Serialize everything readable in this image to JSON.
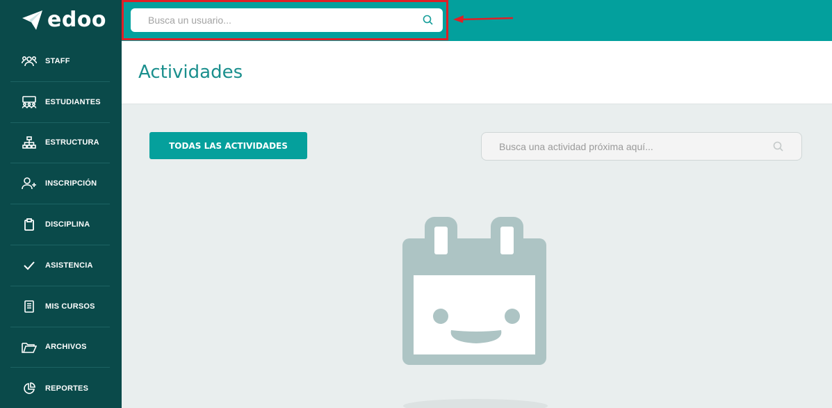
{
  "app": {
    "logo_text": "edoo"
  },
  "sidebar": {
    "items": [
      {
        "label": "STAFF",
        "icon": "staff-icon"
      },
      {
        "label": "ESTUDIANTES",
        "icon": "students-icon"
      },
      {
        "label": "ESTRUCTURA",
        "icon": "structure-icon"
      },
      {
        "label": "INSCRIPCIÓN",
        "icon": "add-user-icon"
      },
      {
        "label": "DISCIPLINA",
        "icon": "clipboard-icon"
      },
      {
        "label": "ASISTENCIA",
        "icon": "checkmark-icon"
      },
      {
        "label": "MIS CURSOS",
        "icon": "book-icon"
      },
      {
        "label": "ARCHIVOS",
        "icon": "folder-icon"
      },
      {
        "label": "REPORTES",
        "icon": "pie-chart-icon"
      }
    ]
  },
  "topbar": {
    "user_search_placeholder": "Busca un usuario..."
  },
  "page": {
    "title": "Actividades"
  },
  "toolbar": {
    "all_activities_label": "TODAS LAS ACTIVIDADES",
    "activity_search_placeholder": "Busca una actividad próxima aquí..."
  },
  "colors": {
    "sidebar_bg": "#0a4a4a",
    "topbar_bg": "#03a09d",
    "accent": "#05a09c",
    "highlight": "#e01f26",
    "illustration": "#adc4c4"
  }
}
